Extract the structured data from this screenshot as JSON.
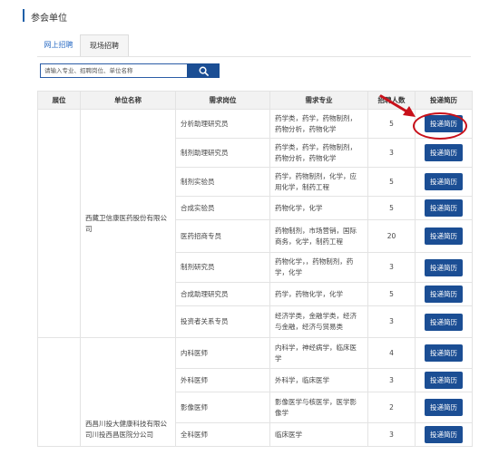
{
  "section": {
    "title": "参会单位"
  },
  "tabs": [
    {
      "label": "网上招聘",
      "active": false
    },
    {
      "label": "现场招聘",
      "active": true
    }
  ],
  "search": {
    "placeholder": "请输入专业、招聘岗位、单位名称",
    "value": ""
  },
  "table": {
    "headers": [
      "展位",
      "单位名称",
      "需求岗位",
      "需求专业",
      "招聘人数",
      "投递简历"
    ],
    "apply_label": "投递简历",
    "companies": [
      {
        "booth": "",
        "name": "西藏卫信康医药股份有限公司"
      },
      {
        "booth": "",
        "name": "西昌川投大健康科技有限公司川投西昌医院分公司"
      }
    ],
    "rows": [
      {
        "position": "分析助理研究员",
        "major": "药学类，药学，药物制剂，药物分析，药物化学",
        "count": "5"
      },
      {
        "position": "制剂助理研究员",
        "major": "药学类，药学，药物制剂，药物分析，药物化学",
        "count": "3"
      },
      {
        "position": "制剂实验员",
        "major": "药学，药物制剂，化学，应用化学，制药工程",
        "count": "5"
      },
      {
        "position": "合成实验员",
        "major": "药物化学，化学",
        "count": "5"
      },
      {
        "position": "医药招商专员",
        "major": "药物制剂，市场营销，国际商务，化学，制药工程",
        "count": "20"
      },
      {
        "position": "制剂研究员",
        "major": "药物化学，，药物制剂，药学，化学",
        "count": "3"
      },
      {
        "position": "合成助理研究员",
        "major": "药学，药物化学，化学",
        "count": "5"
      },
      {
        "position": "投资者关系专员",
        "major": "经济学类，金融学类，经济与金融，经济与贸易类",
        "count": "3"
      },
      {
        "position": "内科医师",
        "major": "内科学，神经病学，临床医学",
        "count": "4"
      },
      {
        "position": "外科医师",
        "major": "外科学，临床医学",
        "count": "3"
      },
      {
        "position": "影像医师",
        "major": "影像医学与核医学，医学影像学",
        "count": "2"
      },
      {
        "position": "全科医师",
        "major": "临床医学",
        "count": "3"
      }
    ]
  },
  "colors": {
    "accent": "#1f5fa8",
    "button": "#1b4e94",
    "highlight": "#c8101a"
  }
}
